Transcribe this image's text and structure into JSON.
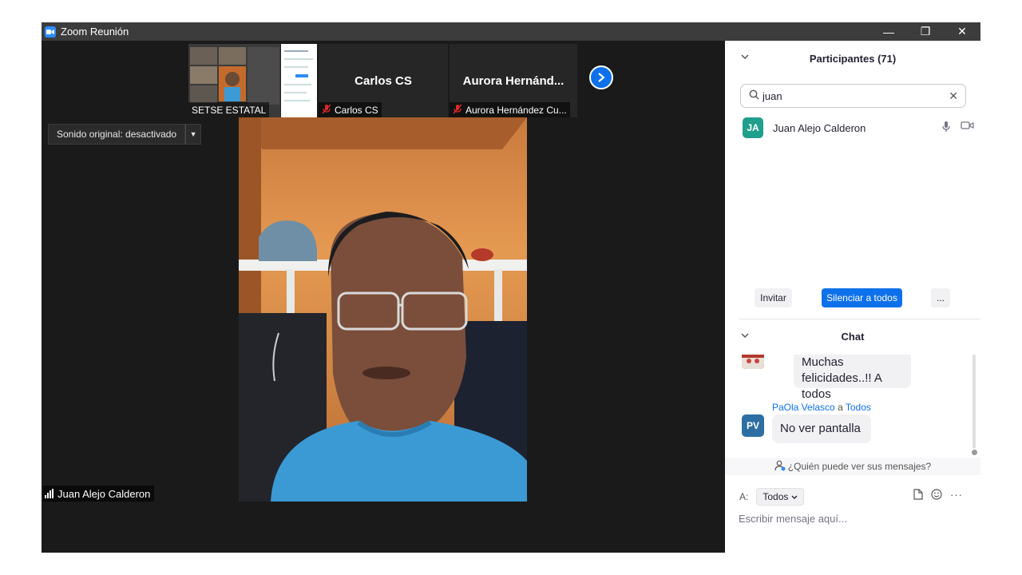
{
  "titlebar": {
    "title": "Zoom Reunión",
    "controls": [
      "—",
      "❐",
      "✕"
    ]
  },
  "gallery": {
    "thumbs": [
      {
        "label": "SETSE ESTATAL"
      },
      {
        "name": "Carlos CS",
        "label": "Carlos CS"
      },
      {
        "name": "Aurora  Hernánd...",
        "label": "Aurora Hernández Cu..."
      }
    ]
  },
  "sound": {
    "label": "Sonido original: desactivado"
  },
  "speaker": {
    "name": "Juan Alejo Calderon"
  },
  "participants": {
    "title": "Participantes (71)",
    "search_value": "juan",
    "items": [
      {
        "initials": "JA",
        "name": "Juan Alejo Calderon",
        "avatar_color": "#1f9f8c"
      }
    ],
    "buttons": {
      "invite": "Invitar",
      "mute_all": "Silenciar a todos",
      "more": "..."
    }
  },
  "chat": {
    "title": "Chat",
    "messages": [
      {
        "text": "Muchas felicidades..!! A todos"
      },
      {
        "sender": "PaOla Velasco",
        "connector": "a",
        "recipient": "Todos",
        "initials": "PV",
        "avatar_color": "#2d6fa3",
        "text": "No ver pantalla"
      }
    ],
    "who_can_see": "¿Quién puede ver sus mensajes?",
    "to_label": "A:",
    "to_value": "Todos",
    "placeholder": "Escribir mensaje aquí..."
  },
  "colors": {
    "accent": "#0e71eb",
    "mute_red": "#e02828"
  }
}
